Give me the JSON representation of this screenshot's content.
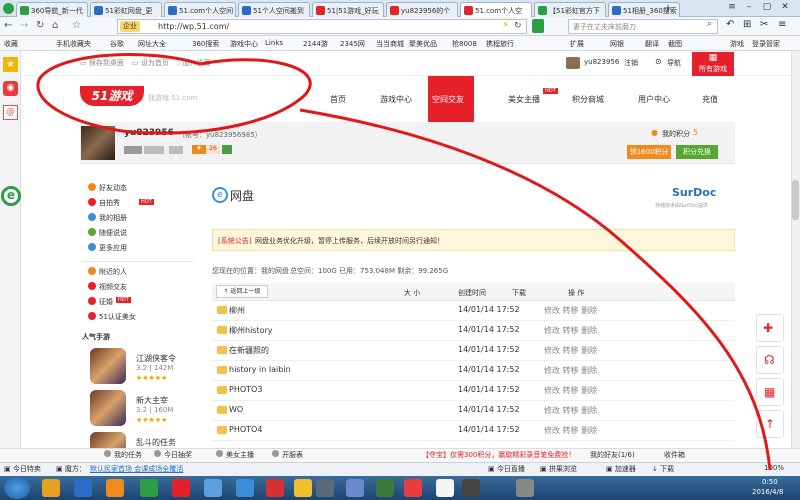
{
  "browser": {
    "tabs": [
      {
        "label": "360导航_新一代",
        "color": "#2e9e44"
      },
      {
        "label": "51彩虹网盘_更",
        "color": "#2b6cc4"
      },
      {
        "label": "51.com个人空间",
        "color": "#2b6cc4"
      },
      {
        "label": "51个人空间搬到",
        "color": "#2b6cc4"
      },
      {
        "label": "51|51游戏_好玩",
        "color": "#e0242a"
      },
      {
        "label": "yu823956的个",
        "color": "#e0242a"
      },
      {
        "label": "51.com个人空",
        "color": "#e0242a",
        "active": true
      },
      {
        "label": "【51彩虹官方下",
        "color": "#2e9e44"
      },
      {
        "label": "51相册_360搜索",
        "color": "#2b6cc4"
      }
    ],
    "new_tab": "+",
    "mode_label": "企业",
    "url": "http://wp.51.com/",
    "search_placeholder": "妻子在丈夫床前磨刀",
    "bookmarks": [
      "收藏",
      "手机收藏夹",
      "谷歌",
      "网址大全",
      "360搜索",
      "游戏中心",
      "Links",
      "2144游",
      "2345网",
      "当当商城",
      "聚美优品",
      "抢8008",
      "携程旅行"
    ],
    "right_tools": [
      "扩展",
      "网银",
      "翻译",
      "截图",
      "游戏",
      "登录管家"
    ]
  },
  "page": {
    "top_links": [
      "保存到桌面",
      "设为首页",
      "加入收藏"
    ],
    "username": "yu823956",
    "logout": "注销",
    "nav_label": "导航",
    "all_games": "所有游戏",
    "logo": "51游戏",
    "logo_sub": "找游戏 51.com",
    "nav": [
      "首页",
      "游戏中心",
      "空间交友",
      "美女主播",
      "积分商城",
      "用户中心",
      "充值"
    ],
    "hot": "HOT",
    "profile_name": "yu823956",
    "profile_account": "（帐号：yu823956985）",
    "my_points_label": "我的积分",
    "my_points": "5",
    "btn_get_points": "领1600积分",
    "btn_exchange": "积分兑换",
    "level_badge": "26",
    "side_menu_a": [
      "好友动态",
      "自拍秀",
      "我的相册",
      "随便说说",
      "更多应用"
    ],
    "side_menu_b": [
      "附近的人",
      "视频交友",
      "征婚",
      "51认证美女"
    ],
    "games_title": "人气手游",
    "games": [
      {
        "name": "江湖侠客令",
        "meta": "3.2 | 142M"
      },
      {
        "name": "新大主宰",
        "meta": "3.2 | 160M"
      },
      {
        "name": "乱斗的任务",
        "meta": ""
      }
    ],
    "disk_title": "网盘",
    "surdoc_brand": "SurDoc",
    "surdoc_sub": "存储技术由SurDoc提供",
    "notice_tag": "[系统公告]",
    "notice": "网盘业务优化升级，暂停上传服务，后续开放时间另行通知！",
    "location": "您现在的位置：我的网盘",
    "capacity": "总空间：100G 已用：753.048M 剩余：99.265G",
    "back_btn": "返回上一级",
    "col_size": "大 小",
    "col_created": "创建时间",
    "col_download": "下载",
    "col_ops": "操 作",
    "rows": [
      {
        "name": "柳州",
        "date": "14/01/14 17:52",
        "ops": "修改 转移 删除"
      },
      {
        "name": "柳州history",
        "date": "14/01/14 17:52",
        "ops": "修改 转移 删除"
      },
      {
        "name": "在新疆照的",
        "date": "14/01/14 17:52",
        "ops": "修改 转移 删除"
      },
      {
        "name": "history in laibin",
        "date": "14/01/14 17:52",
        "ops": "修改 转移 删除"
      },
      {
        "name": "PHOTO3",
        "date": "14/01/14 17:52",
        "ops": "修改 转移 删除"
      },
      {
        "name": "WO",
        "date": "14/01/14 17:52",
        "ops": "修改 转移 删除"
      },
      {
        "name": "PHOTO4",
        "date": "14/01/14 17:52",
        "ops": "修改 转移 删除"
      }
    ],
    "bottom_bar": [
      "我的任务",
      "今日抽奖",
      "美女主播",
      "开服表"
    ],
    "bottom_promo": "【夺宝】仅需300积分，赢取精彩录音笔免费抢！",
    "bottom_right": [
      "我的好友(1/6)",
      "收件箱"
    ]
  },
  "status": {
    "items": [
      "今日特卖",
      "魔方：",
      "默认民家首场 会课成场全覆活"
    ],
    "right": [
      "今日直播",
      "拼果浏览",
      "加速器",
      "下载"
    ],
    "zoom": "100%"
  },
  "taskbar": {
    "time": "0:50",
    "date": "2016/4/8"
  }
}
